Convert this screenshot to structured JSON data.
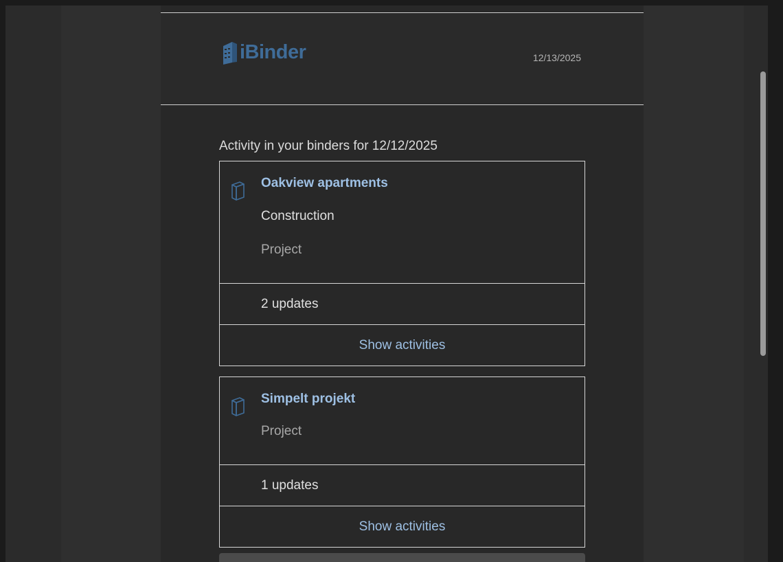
{
  "header": {
    "logo_text": "iBinder",
    "date": "12/13/2025"
  },
  "intro": "Activity in your binders for 12/12/2025",
  "binders": [
    {
      "title": "Oakview apartments",
      "category": "Construction",
      "type": "Project",
      "updates": "2 updates",
      "link": "Show activities"
    },
    {
      "title": "Simpelt projekt",
      "type": "Project",
      "updates": "1 updates",
      "link": "Show activities"
    }
  ],
  "icons": {
    "logo": "ibinder-logo-icon",
    "binder": "binder-icon"
  },
  "colors": {
    "accent": "#9ec0e4",
    "logo": "#3f6c98",
    "background": "#282828"
  }
}
